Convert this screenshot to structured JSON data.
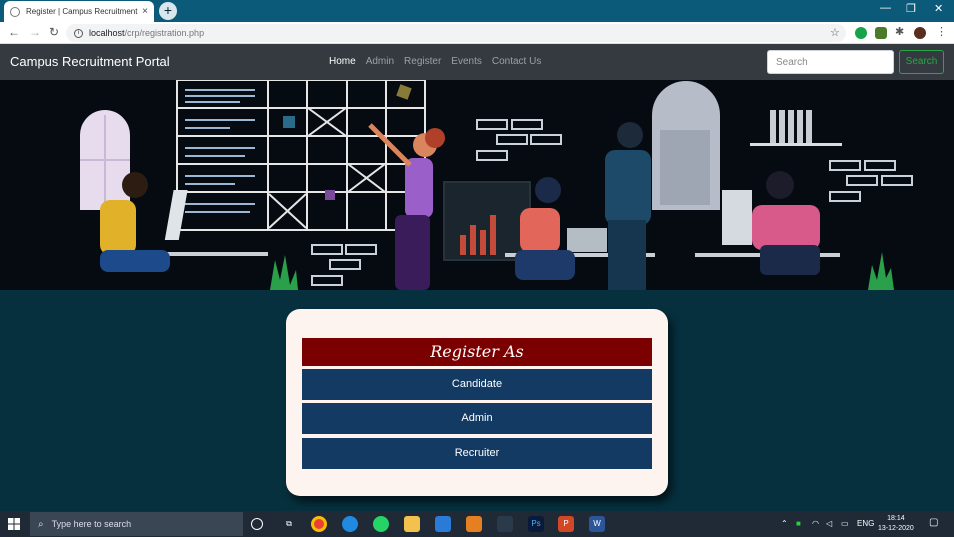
{
  "browser": {
    "tab_title": "Register | Campus Recruitment S",
    "tab_close": "×",
    "new_tab": "+",
    "url_host": "localhost",
    "url_path": "/crp/registration.php"
  },
  "site": {
    "brand": "Campus Recruitment Portal",
    "nav": [
      "Home",
      "Admin",
      "Register",
      "Events",
      "Contact Us"
    ],
    "search_placeholder": "Search",
    "search_button": "Search"
  },
  "register": {
    "heading": "Register As",
    "options": [
      "Candidate",
      "Admin",
      "Recruiter"
    ]
  },
  "taskbar": {
    "search_placeholder": "Type here to search",
    "lang": "ENG",
    "time": "18:14",
    "date": "13-12-2020"
  },
  "colors": {
    "navbar": "#343a40",
    "heading_bg": "#7b0000",
    "option_bg": "#123a63",
    "page_bg": "#06303e",
    "search_green": "#28a745"
  }
}
